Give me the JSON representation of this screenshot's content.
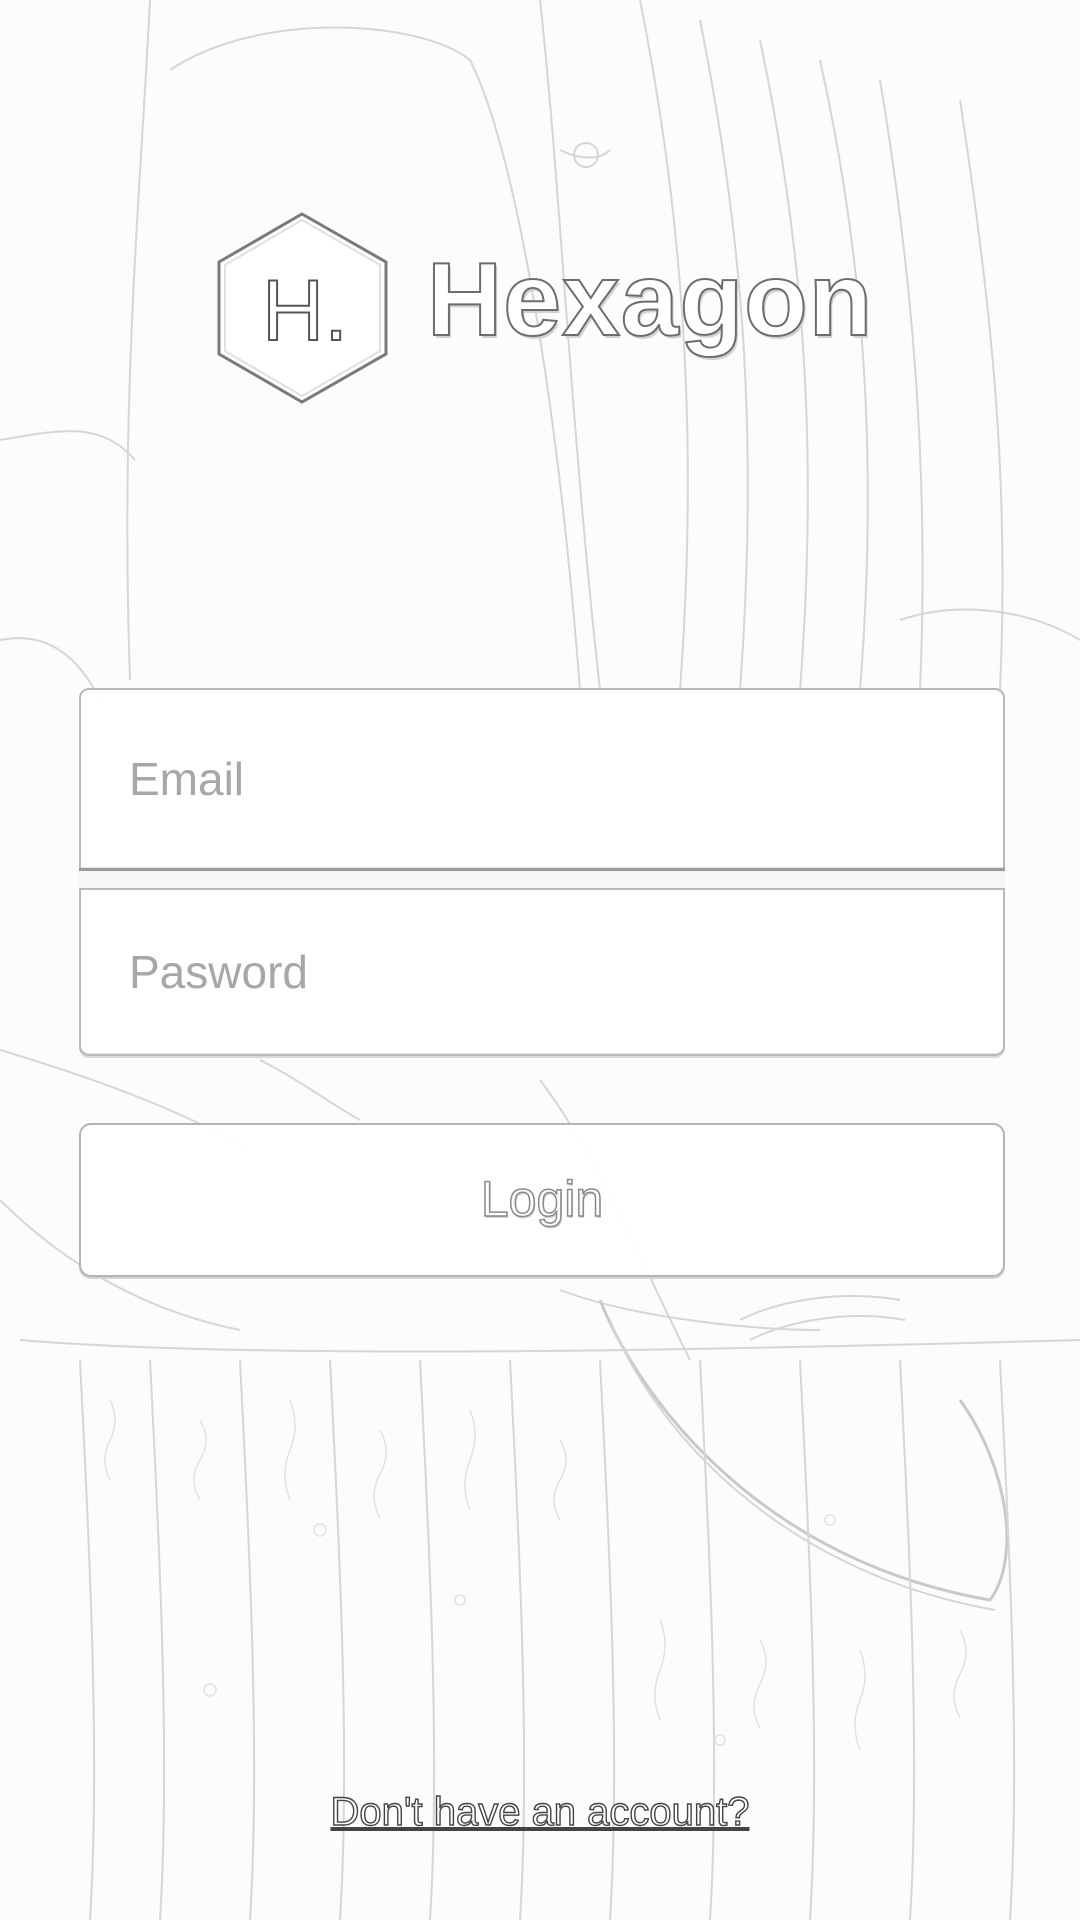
{
  "app": {
    "name": "Hexagon",
    "logo_letter": "H."
  },
  "form": {
    "email_placeholder": "Email",
    "email_value": "",
    "password_placeholder": "Pasword",
    "password_value": "",
    "login_label": "Login"
  },
  "footer": {
    "signup_link": "Don't have an account?"
  },
  "icons": {
    "logo": "hexagon-logo-icon"
  },
  "colors": {
    "background": "#fcfcfc",
    "field_border": "#b9b9b9",
    "placeholder": "#a7a7a7",
    "text_outline": "#6d6d6d"
  }
}
